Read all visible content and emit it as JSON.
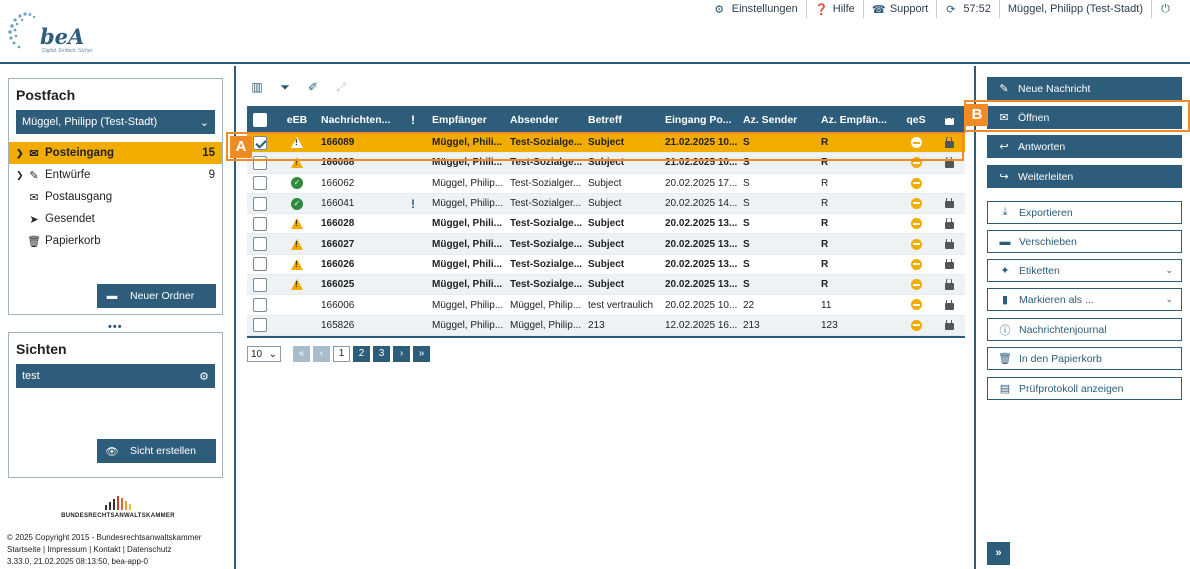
{
  "header": {
    "logo_text": "beA",
    "logo_sub": "Digital. Einfach. Sicher.",
    "nav": [
      {
        "icon": "gear-icon",
        "label": "Einstellungen"
      },
      {
        "icon": "help-icon",
        "label": "Hilfe"
      },
      {
        "icon": "support-icon",
        "label": "Support"
      },
      {
        "icon": "refresh-icon",
        "label": "57:52"
      },
      {
        "icon": "",
        "label": "Müggel, Philipp (Test-Stadt)"
      },
      {
        "icon": "power-icon",
        "label": ""
      }
    ]
  },
  "postfach": {
    "title": "Postfach",
    "selected_account": "Müggel, Philipp (Test-Stadt)",
    "folders": [
      {
        "label": "Posteingang",
        "count": "15"
      },
      {
        "label": "Entwürfe",
        "count": "9"
      },
      {
        "label": "Postausgang",
        "count": ""
      },
      {
        "label": "Gesendet",
        "count": ""
      },
      {
        "label": "Papierkorb",
        "count": ""
      }
    ],
    "new_folder_label": "Neuer Ordner"
  },
  "sichten": {
    "title": "Sichten",
    "selected": "test",
    "create_label": "Sicht erstellen"
  },
  "footer": {
    "org": "BUNDESRECHTSANWALTSKAMMER",
    "copyright": "© 2025 Copyright 2015 - Bundesrechtsanwaltskammer",
    "links": "Startseite | Impressum | Kontakt | Datenschutz",
    "version": "3.33.0, 21.02.2025 08:13:50, bea-app-0"
  },
  "table": {
    "columns": [
      "eEB",
      "Nachrichten...",
      "!",
      "Empfänger",
      "Absender",
      "Betreff",
      "Eingang Po...",
      "Az. Sender",
      "Az. Empfän...",
      "qeS"
    ],
    "rows": [
      {
        "id": "166089",
        "status": "warn",
        "excl": "",
        "recipient": "Müggel, Phili...",
        "sender": "Test-Sozialge...",
        "subject": "Subject",
        "received": "21.02.2025 10...",
        "az_sender": "S",
        "az_recipient": "R",
        "bold": true,
        "selected": true
      },
      {
        "id": "166088",
        "status": "warn",
        "excl": "",
        "recipient": "Müggel, Phili...",
        "sender": "Test-Sozialge...",
        "subject": "Subject",
        "received": "21.02.2025 10...",
        "az_sender": "S",
        "az_recipient": "R",
        "bold": true,
        "selected": false
      },
      {
        "id": "166062",
        "status": "ok",
        "excl": "",
        "recipient": "Müggel, Philip...",
        "sender": "Test-Sozialger...",
        "subject": "Subject",
        "received": "20.02.2025 17...",
        "az_sender": "S",
        "az_recipient": "R",
        "bold": false,
        "selected": false
      },
      {
        "id": "166041",
        "status": "ok",
        "excl": "!",
        "recipient": "Müggel, Philip...",
        "sender": "Test-Sozialger...",
        "subject": "Subject",
        "received": "20.02.2025 14...",
        "az_sender": "S",
        "az_recipient": "R",
        "bold": false,
        "selected": false
      },
      {
        "id": "166028",
        "status": "warn",
        "excl": "",
        "recipient": "Müggel, Phili...",
        "sender": "Test-Sozialge...",
        "subject": "Subject",
        "received": "20.02.2025 13...",
        "az_sender": "S",
        "az_recipient": "R",
        "bold": true,
        "selected": false
      },
      {
        "id": "166027",
        "status": "warn",
        "excl": "",
        "recipient": "Müggel, Phili...",
        "sender": "Test-Sozialge...",
        "subject": "Subject",
        "received": "20.02.2025 13...",
        "az_sender": "S",
        "az_recipient": "R",
        "bold": true,
        "selected": false
      },
      {
        "id": "166026",
        "status": "warn",
        "excl": "",
        "recipient": "Müggel, Phili...",
        "sender": "Test-Sozialge...",
        "subject": "Subject",
        "received": "20.02.2025 13...",
        "az_sender": "S",
        "az_recipient": "R",
        "bold": true,
        "selected": false
      },
      {
        "id": "166025",
        "status": "warn",
        "excl": "",
        "recipient": "Müggel, Phili...",
        "sender": "Test-Sozialge...",
        "subject": "Subject",
        "received": "20.02.2025 13...",
        "az_sender": "S",
        "az_recipient": "R",
        "bold": true,
        "selected": false
      },
      {
        "id": "166006",
        "status": "",
        "excl": "",
        "recipient": "Müggel, Philip...",
        "sender": "Müggel, Philip...",
        "subject": "test vertraulich",
        "received": "20.02.2025 10...",
        "az_sender": "22",
        "az_recipient": "11",
        "bold": false,
        "selected": false
      },
      {
        "id": "165826",
        "status": "",
        "excl": "",
        "recipient": "Müggel, Philip...",
        "sender": "Müggel, Philip...",
        "subject": "213",
        "received": "12.02.2025 16...",
        "az_sender": "213",
        "az_recipient": "123",
        "bold": false,
        "selected": false
      }
    ]
  },
  "pager": {
    "page_size": "10",
    "pages": [
      "1",
      "2",
      "3"
    ],
    "current": "1"
  },
  "actions": [
    {
      "label": "Neue Nachricht",
      "icon": "pencil-icon",
      "style": "dark"
    },
    {
      "label": "Öffnen",
      "icon": "envelope-icon",
      "style": "dark"
    },
    {
      "label": "Antworten",
      "icon": "reply-icon",
      "style": "dark"
    },
    {
      "label": "Weiterleiten",
      "icon": "forward-icon",
      "style": "dark"
    },
    {
      "label": "Exportieren",
      "icon": "download-icon",
      "style": "light"
    },
    {
      "label": "Verschieben",
      "icon": "folder-icon",
      "style": "light"
    },
    {
      "label": "Etiketten",
      "icon": "tag-icon",
      "style": "light"
    },
    {
      "label": "Markieren als ...",
      "icon": "bookmark-icon",
      "style": "light"
    },
    {
      "label": "Nachrichtenjournal",
      "icon": "info-icon",
      "style": "light"
    },
    {
      "label": "In den Papierkorb",
      "icon": "trash-icon",
      "style": "light"
    },
    {
      "label": "Prüfprotokoll anzeigen",
      "icon": "document-icon",
      "style": "light"
    }
  ],
  "annotations": {
    "a": "A",
    "b": "B"
  },
  "colors": {
    "primary": "#2d5d7b",
    "selected_row": "#f2ac00",
    "highlight": "#f08a24"
  }
}
